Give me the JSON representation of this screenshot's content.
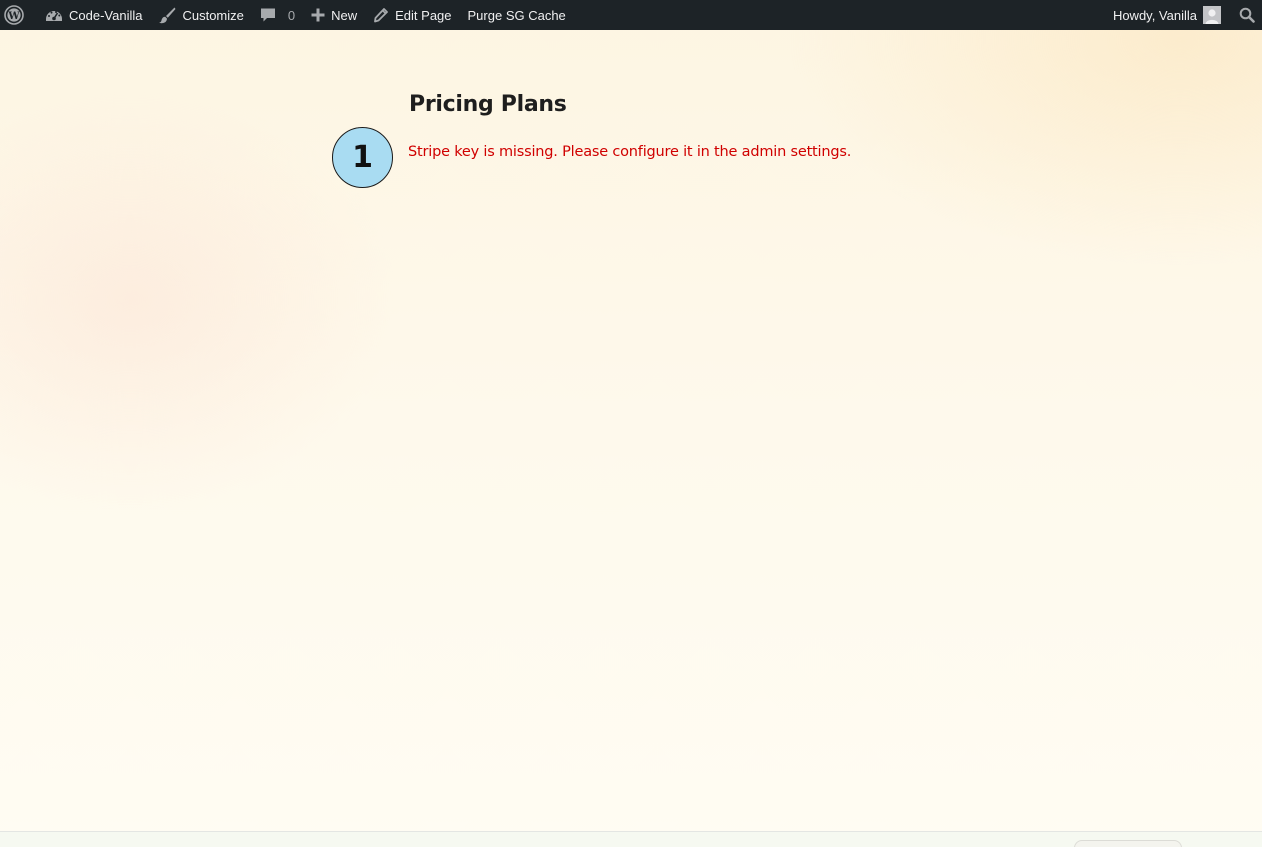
{
  "adminbar": {
    "site_name": "Code-Vanilla",
    "customize_label": "Customize",
    "comments_count": "0",
    "new_label": "New",
    "edit_label": "Edit Page",
    "purge_label": "Purge SG Cache",
    "greeting": "Howdy, Vanilla"
  },
  "page": {
    "step_number": "1",
    "title": "Pricing Plans",
    "error_message": "Stripe key is missing. Please configure it in the admin settings."
  },
  "colors": {
    "adminbar_bg": "#1d2327",
    "error_text": "#d00000",
    "badge_fill": "#a9dcf2"
  },
  "icons": [
    "wordpress-icon",
    "dashboard-icon",
    "brush-icon",
    "comment-icon",
    "plus-icon",
    "pencil-icon",
    "avatar-icon",
    "search-icon"
  ]
}
